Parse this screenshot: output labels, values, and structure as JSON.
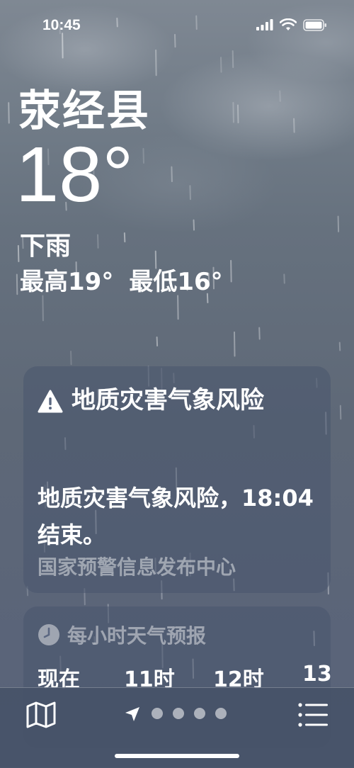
{
  "status_bar": {
    "time": "10:45"
  },
  "weather": {
    "city": "荥经县",
    "temperature": "18°",
    "condition": "下雨",
    "high": "最高19°",
    "low": "最低16°"
  },
  "alert": {
    "icon": "warning-triangle-icon",
    "title": "地质灾害气象风险",
    "body": "地质灾害气象风险，18:04 结束。",
    "source": "国家预警信息发布中心"
  },
  "hourly": {
    "icon": "clock-icon",
    "title": "每小时天气预报",
    "hours": [
      "现在",
      "11时",
      "12时",
      "13"
    ]
  },
  "bottom_bar": {
    "page_count": 4,
    "map_icon": "map-icon",
    "location_icon": "location-arrow-icon",
    "list_icon": "list-icon"
  }
}
